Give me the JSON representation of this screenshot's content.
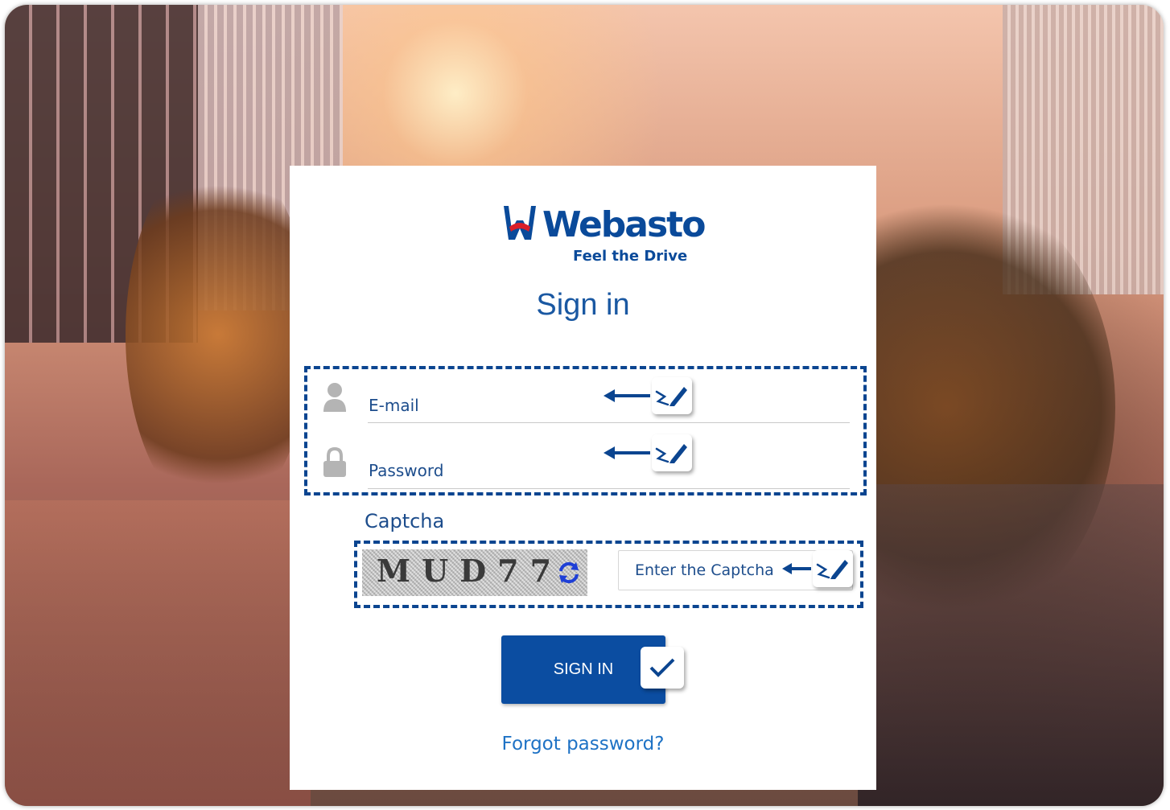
{
  "brand": {
    "name": "Webasto",
    "tagline": "Feel the Drive"
  },
  "form": {
    "title": "Sign in",
    "email_label": "E-mail",
    "password_label": "Password",
    "captcha_label": "Captcha",
    "captcha_text": "MUD77",
    "captcha_placeholder": "Enter the Captcha",
    "submit_label": "SIGN IN",
    "forgot_label": "Forgot password?"
  },
  "icons": {
    "email": "user-icon",
    "password": "lock-icon",
    "refresh": "refresh-icon",
    "hint_arrow": "arrow-left-icon",
    "hint_pen": "pen-icon",
    "submit_check": "checkmark-icon"
  },
  "colors": {
    "brand_blue": "#0b4da1",
    "link_blue": "#1e72c5",
    "brand_red": "#d91e2a",
    "highlight_dash": "#0b4590"
  }
}
